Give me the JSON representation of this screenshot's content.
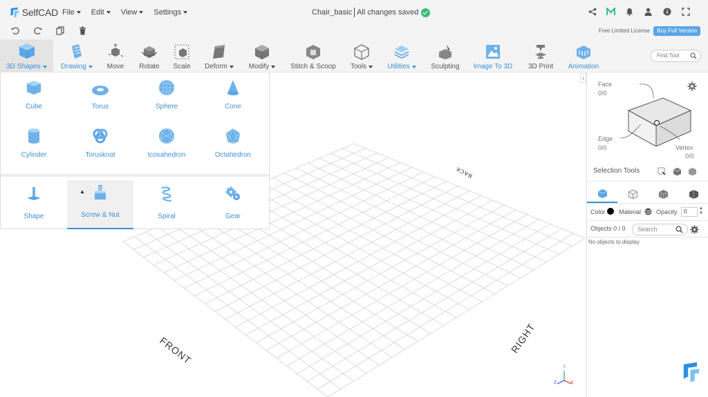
{
  "app": {
    "name": "SelfCAD"
  },
  "menu": {
    "file": "File",
    "edit": "Edit",
    "view": "View",
    "settings": "Settings"
  },
  "project": {
    "name": "Chair_basic",
    "status": "All changes saved"
  },
  "license": {
    "text": "Free Limited License",
    "buy_label": "Buy Full Version"
  },
  "toolbar": {
    "shapes": "3D Shapes",
    "drawing": "Drawing",
    "move": "Move",
    "rotate": "Rotate",
    "scale": "Scale",
    "deform": "Deform",
    "modify": "Modify",
    "stitch": "Stitch & Scoop",
    "tools": "Tools",
    "utilities": "Utilities",
    "sculpting": "Sculpting",
    "image3d": "Image To 3D",
    "print": "3D Print",
    "animation": "Animation",
    "find_placeholder": "Find Tool"
  },
  "shapes": {
    "primitives": [
      "Cube",
      "Torus",
      "Sphere",
      "Cone",
      "Cylinder",
      "Torusknot",
      "Icosahedron",
      "Octahedron"
    ],
    "generators": [
      "Shape",
      "Screw & Nut",
      "Spiral",
      "Gear"
    ],
    "selected": "Screw & Nut"
  },
  "viewport": {
    "front": "FRONT",
    "right": "RIGHT",
    "back": "BACK",
    "axis_x": "X",
    "axis_y": "Y",
    "axis_z": "Z"
  },
  "selection": {
    "face_label": "Face",
    "face_count": "0/0",
    "edge_label": "Edge",
    "edge_count": "0/0",
    "vertex_label": "Vertex",
    "vertex_count": "0/0",
    "tools_label": "Selection Tools"
  },
  "properties": {
    "color_label": "Color",
    "material_label": "Material",
    "opacity_label": "Opacity",
    "opacity_value": "0"
  },
  "objects": {
    "label": "Objects 0 / 0",
    "search_placeholder": "Search",
    "empty": "No objects to display"
  },
  "colors": {
    "accent": "#3d8fd6",
    "shape_icon": "#6fb1ea",
    "buy_button": "#5aa6e6",
    "saved": "#3cb97c"
  }
}
